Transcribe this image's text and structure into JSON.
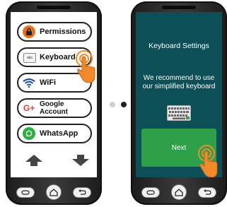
{
  "left_phone": {
    "menu": [
      {
        "label": "Permissions",
        "icon": "lock-icon",
        "color": "#e8701a"
      },
      {
        "label": "Keyboard",
        "icon": "keyboard-icon",
        "color": "#ffffff"
      },
      {
        "label": "WiFi",
        "icon": "wifi-icon",
        "color": "#1a4aa0"
      },
      {
        "label": "Google\nAccount",
        "icon": "google-plus-icon",
        "color": "#d64333"
      },
      {
        "label": "WhatsApp",
        "icon": "whatsapp-icon",
        "color": "#2bb040"
      }
    ],
    "keyboard_icon_text": "abc"
  },
  "right_phone": {
    "title": "Keyboard Settings",
    "message": "We recommend to use our simplified keyboard",
    "next_label": "Next"
  },
  "colors": {
    "accent_orange": "#f08a2a",
    "screen_teal": "#0c4f57",
    "next_green": "#2ea049"
  }
}
